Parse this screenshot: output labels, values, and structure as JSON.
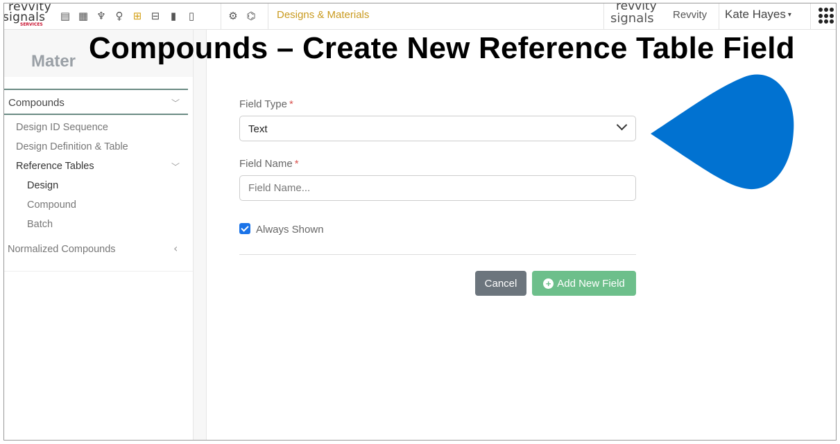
{
  "header": {
    "logo_top": "revvity",
    "logo_bottom": "signals",
    "logo_sub": "SERVICES",
    "icons": [
      "form-icon",
      "building-icon",
      "handshake-icon",
      "lightbulb-icon",
      "table-icon",
      "toolbox-icon",
      "clipboard-icon",
      "document-icon",
      "gear-icon",
      "puzzle-icon"
    ],
    "app_title": "Designs & Materials",
    "brand_top": "revvity",
    "brand_bottom": "signals",
    "brand_link": "Revvity",
    "user_name": "Kate Hayes",
    "user_caret": "▾"
  },
  "overlay_title": "Compounds – Create New Reference Table Field",
  "sidebar": {
    "title": "Mater",
    "section": "Compounds",
    "items": [
      {
        "label": "Design ID Sequence"
      },
      {
        "label": "Design Definition & Table"
      },
      {
        "label": "Reference Tables"
      },
      {
        "label": "Design"
      },
      {
        "label": "Compound"
      },
      {
        "label": "Batch"
      },
      {
        "label": "Normalized Compounds"
      }
    ]
  },
  "form": {
    "field_type_label": "Field Type",
    "field_type_value": "Text",
    "field_name_label": "Field Name",
    "field_name_placeholder": "Field Name...",
    "required_marker": "*",
    "always_shown_label": "Always Shown",
    "always_shown_checked": true,
    "cancel_label": "Cancel",
    "add_label": "Add New Field"
  },
  "colors": {
    "accent_gold": "#c99a1e",
    "checkbox_blue": "#1a73e8",
    "add_button": "#6dbf8b",
    "cancel_button": "#6c757d",
    "drop_blue": "#0172d1"
  }
}
